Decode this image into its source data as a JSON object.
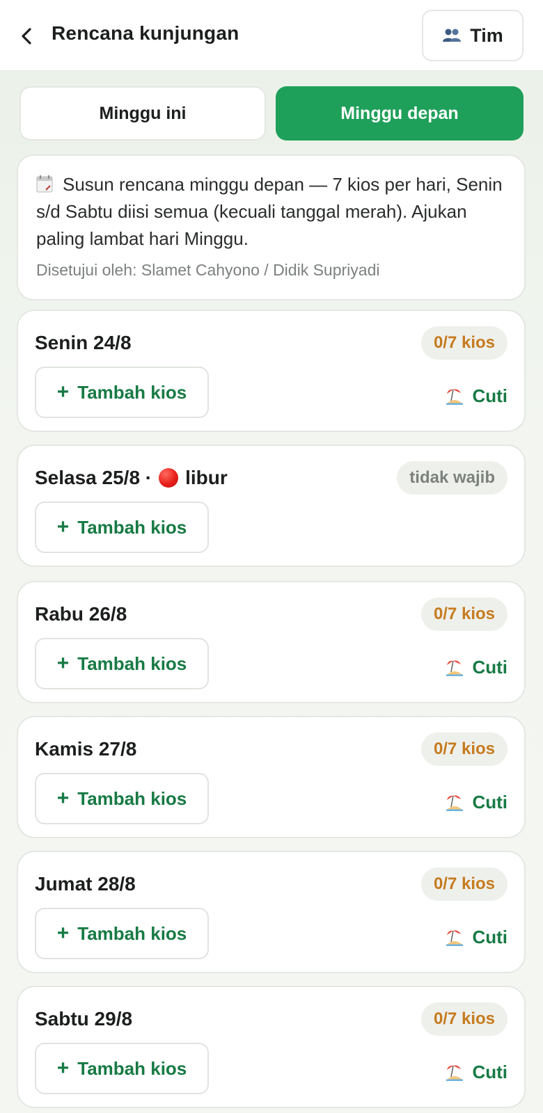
{
  "header": {
    "title": "Rencana kunjungan",
    "team_label": "Tim"
  },
  "tabs": [
    {
      "label": "Minggu ini",
      "active": false
    },
    {
      "label": "Minggu depan",
      "active": true
    }
  ],
  "info": {
    "text": "Susun rencana minggu depan — 7 kios per hari, Senin s/d Sabtu diisi semua (kecuali tanggal merah). Ajukan paling lambat hari Minggu.",
    "approvers": "Disetujui oleh: Slamet Cahyono / Didik Supriyadi"
  },
  "days": [
    {
      "title": "Senin 24/8",
      "badge": "0/7 kios",
      "add_label": "Tambah kios",
      "leave_label": "Cuti"
    },
    {
      "title": "Selasa 25/8 ·",
      "holiday_label": "libur",
      "badge": "tidak wajib",
      "add_label": "Tambah kios"
    },
    {
      "title": "Rabu 26/8",
      "badge": "0/7 kios",
      "add_label": "Tambah kios",
      "leave_label": "Cuti"
    },
    {
      "title": "Kamis 27/8",
      "badge": "0/7 kios",
      "add_label": "Tambah kios",
      "leave_label": "Cuti"
    },
    {
      "title": "Jumat 28/8",
      "badge": "0/7 kios",
      "add_label": "Tambah kios",
      "leave_label": "Cuti"
    },
    {
      "title": "Sabtu 29/8",
      "badge": "0/7 kios",
      "add_label": "Tambah kios",
      "leave_label": "Cuti"
    }
  ],
  "icons": {
    "back": "chevron-left-icon",
    "team": "people-icon",
    "calendar": "calendar-icon",
    "holiday": "red-circle-icon",
    "add": "plus-icon",
    "leave": "beach-island-icon"
  },
  "colors": {
    "primary": "#1fa05a",
    "primary_text": "#177a44",
    "badge_count": "#c67b1e",
    "muted": "#7c817d"
  }
}
